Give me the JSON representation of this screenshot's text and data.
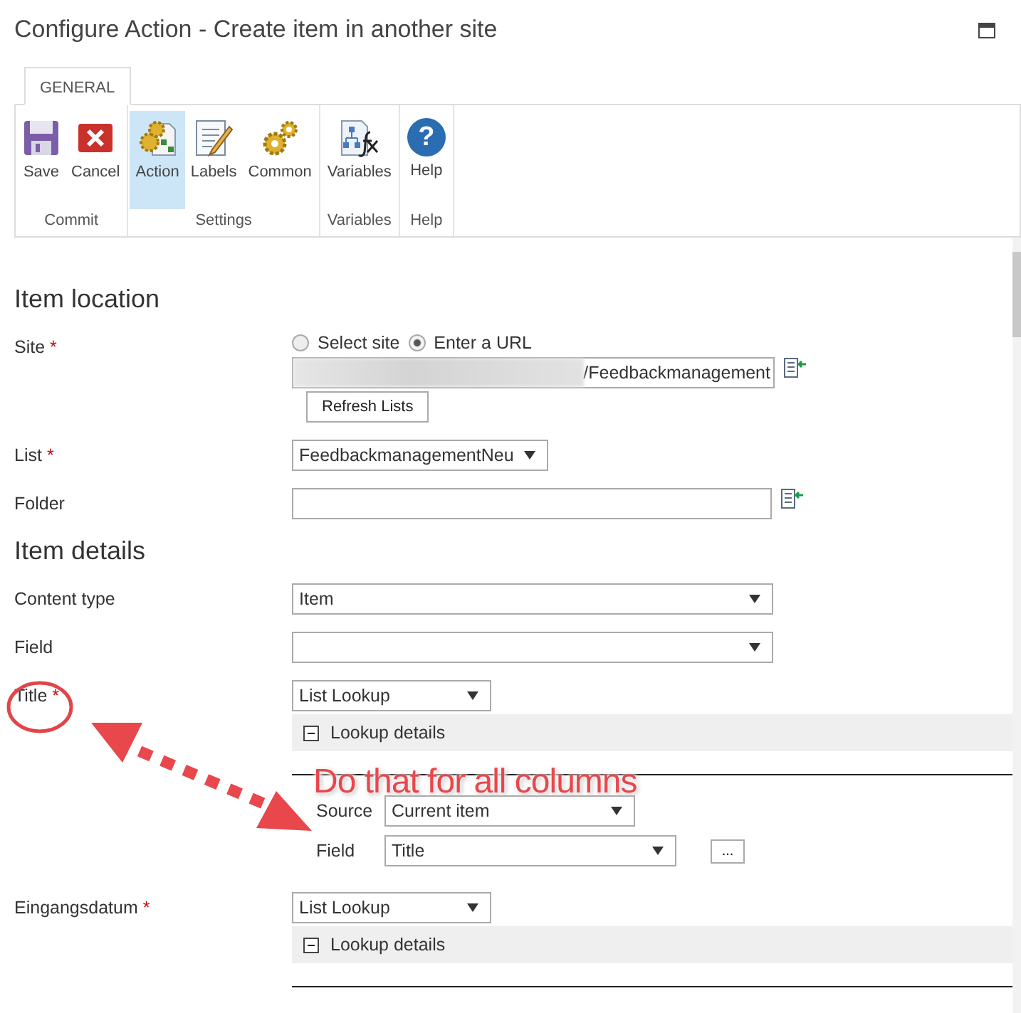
{
  "window": {
    "title": "Configure Action - Create item in another site"
  },
  "ribbon": {
    "tabs": [
      {
        "label": "GENERAL",
        "selected": true
      }
    ],
    "groups": [
      {
        "label": "Commit",
        "buttons": [
          {
            "label": "Save",
            "selected": false
          },
          {
            "label": "Cancel",
            "selected": false
          }
        ]
      },
      {
        "label": "Settings",
        "buttons": [
          {
            "label": "Action",
            "selected": true
          },
          {
            "label": "Labels",
            "selected": false
          },
          {
            "label": "Common",
            "selected": false
          }
        ]
      },
      {
        "label": "Variables",
        "buttons": [
          {
            "label": "Variables",
            "selected": false
          }
        ]
      },
      {
        "label": "Help",
        "buttons": [
          {
            "label": "Help",
            "selected": false,
            "glyph": "?"
          }
        ]
      }
    ]
  },
  "sections": [
    {
      "heading": "Item location",
      "fields": [
        {
          "kind": "site",
          "label": "Site",
          "required_mark": "*",
          "radios": [
            {
              "label": "Select site",
              "selected": false
            },
            {
              "label": "Enter a URL",
              "selected": true
            }
          ],
          "value": "/Feedbackmanagement",
          "button": "Refresh Lists"
        },
        {
          "kind": "dropdown-short",
          "label": "List",
          "required_mark": "*",
          "value": "FeedbackmanagementNeu"
        },
        {
          "kind": "input",
          "label": "Folder"
        }
      ]
    },
    {
      "heading": "Item details",
      "fields": [
        {
          "kind": "dropdown-wide",
          "label": "Content type",
          "value": "Item"
        },
        {
          "kind": "dropdown-wide",
          "label": "Field"
        },
        {
          "kind": "lookup",
          "label": "Title",
          "required_mark": "*",
          "value": "List Lookup",
          "details": "Lookup details",
          "expanded": true,
          "rows": [
            {
              "label": "Source",
              "value": "Current item"
            },
            {
              "label": "Field",
              "value": "Title",
              "more_label": "..."
            }
          ]
        },
        {
          "kind": "lookup",
          "label": "Eingangsdatum",
          "required_mark": "*",
          "value": "List Lookup",
          "details": "Lookup details",
          "expanded": true
        }
      ]
    }
  ],
  "annotation": {
    "text": "Do that for all columns"
  }
}
